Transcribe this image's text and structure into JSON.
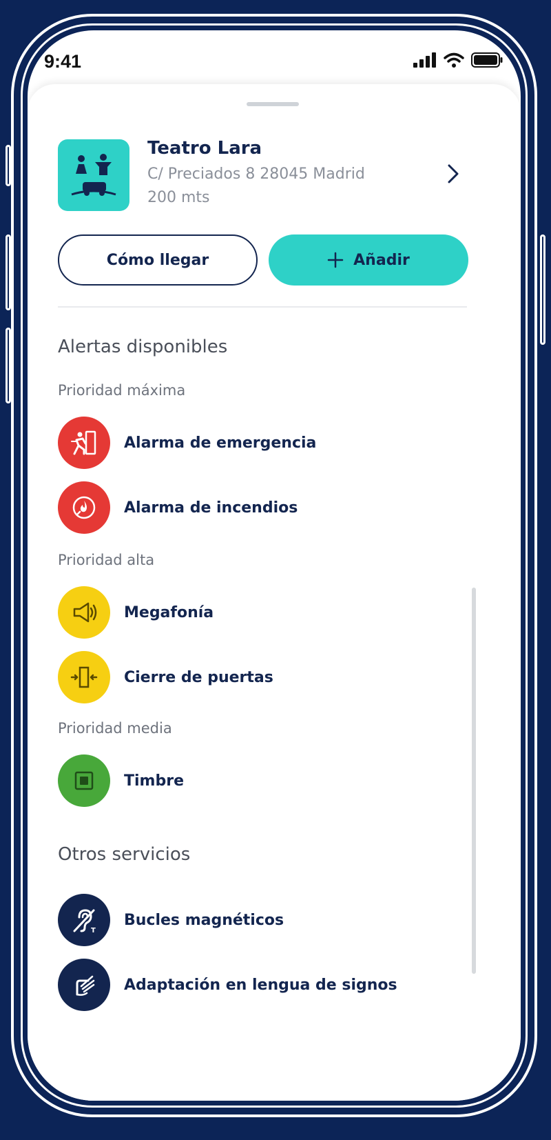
{
  "status_bar": {
    "time": "9:41"
  },
  "venue": {
    "name": "Teatro Lara",
    "address": "C/ Preciados 8 28045 Madrid",
    "distance": "200 mts",
    "logo_color": "#2ed1c7"
  },
  "actions": {
    "directions_label": "Cómo llegar",
    "add_label": "Añadir",
    "add_icon": "plus-icon"
  },
  "alerts_section": {
    "title": "Alertas disponibles",
    "groups": [
      {
        "label": "Prioridad máxima",
        "color": "#e53935",
        "items": [
          {
            "label": "Alarma de emergencia",
            "icon": "emergency-exit-icon"
          },
          {
            "label": "Alarma de incendios",
            "icon": "fire-alarm-icon"
          }
        ]
      },
      {
        "label": "Prioridad alta",
        "color": "#f6cf12",
        "items": [
          {
            "label": "Megafonía",
            "icon": "megaphone-icon"
          },
          {
            "label": "Cierre de puertas",
            "icon": "door-closing-icon"
          }
        ]
      },
      {
        "label": "Prioridad media",
        "color": "#48a83a",
        "items": [
          {
            "label": "Timbre",
            "icon": "doorbell-icon"
          }
        ]
      }
    ]
  },
  "other_services": {
    "title": "Otros servicios",
    "color": "#13254f",
    "items": [
      {
        "label": "Bucles magnéticos",
        "icon": "hearing-loop-icon"
      },
      {
        "label": "Adaptación en lengua de signos",
        "icon": "sign-language-icon"
      }
    ]
  }
}
